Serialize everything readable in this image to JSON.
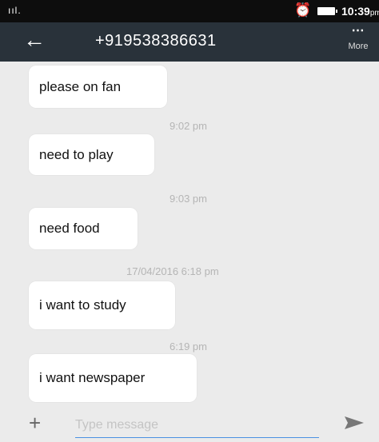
{
  "status_bar": {
    "signal": "ııl.",
    "alarm_icon": "alarm-clock-icon",
    "battery_icon": "battery-icon",
    "time": "10:39",
    "ampm": "pm"
  },
  "app_bar": {
    "back_icon": "arrow-left-icon",
    "title": "+919538386631",
    "more_icon": "⋯",
    "more_label": "More"
  },
  "conversation": [
    {
      "type": "message",
      "text": "please on fan"
    },
    {
      "type": "timestamp",
      "text": "9:02 pm"
    },
    {
      "type": "message",
      "text": "need to play"
    },
    {
      "type": "timestamp",
      "text": "9:03 pm"
    },
    {
      "type": "message",
      "text": "need food"
    },
    {
      "type": "timestamp",
      "text": "17/04/2016 6:18 pm"
    },
    {
      "type": "message",
      "text": "i want to study"
    },
    {
      "type": "timestamp",
      "text": "6:19 pm"
    },
    {
      "type": "message",
      "text": "i want newspaper"
    }
  ],
  "composer": {
    "add_icon": "+",
    "placeholder": "Type message",
    "value": "",
    "send_icon": "send-icon"
  },
  "colors": {
    "app_bar": "#29323a",
    "status_bar": "#0d0d0d",
    "background": "#ebebeb",
    "input_underline": "#4a90e2"
  }
}
